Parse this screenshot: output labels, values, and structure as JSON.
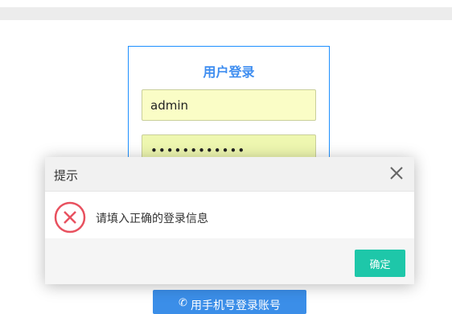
{
  "login": {
    "title": "用户登录",
    "username_value": "admin",
    "password_value": "••••••••••••",
    "phone_login_label": "用手机号登录账号"
  },
  "dialog": {
    "title": "提示",
    "message": "请填入正确的登录信息",
    "ok_label": "确定",
    "icons": {
      "close": "close-icon",
      "status": "error-x-icon"
    }
  },
  "colors": {
    "accent_blue": "#3f8ef0",
    "input_bg": "#fafdc6",
    "ok_button": "#1ec7a9",
    "error_red": "#e8515f"
  }
}
